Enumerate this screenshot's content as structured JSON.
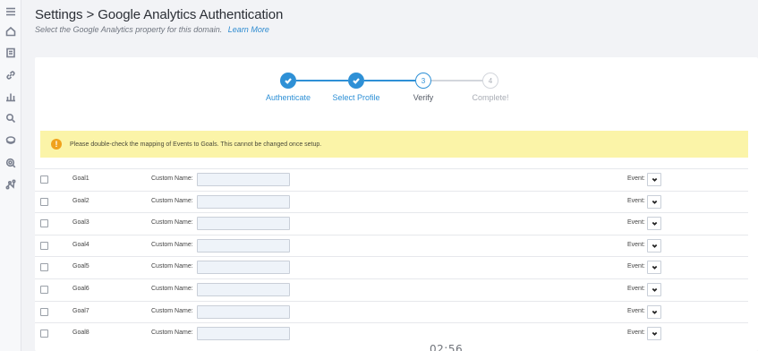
{
  "header": {
    "title": "Settings > Google Analytics Authentication",
    "subtitle": "Select the Google Analytics property for this domain.",
    "learn_more": "Learn More"
  },
  "sidebar": {
    "icons": [
      "menu-icon",
      "home-icon",
      "document-icon",
      "link-icon",
      "bar-chart-icon",
      "search-icon",
      "layers-icon",
      "zoom-icon",
      "network-icon"
    ]
  },
  "stepper": {
    "steps": [
      {
        "label": "Authenticate",
        "state": "done",
        "number": ""
      },
      {
        "label": "Select Profile",
        "state": "done",
        "number": ""
      },
      {
        "label": "Verify",
        "state": "current",
        "number": "3"
      },
      {
        "label": "Complete!",
        "state": "todo",
        "number": "4"
      }
    ]
  },
  "alert": {
    "icon": "!",
    "text": "Please double-check the mapping of Events to Goals. This cannot be changed once setup."
  },
  "goals": {
    "custom_name_label": "Custom Name:",
    "event_label": "Event:",
    "rows": [
      {
        "name": "Goal1"
      },
      {
        "name": "Goal2"
      },
      {
        "name": "Goal3"
      },
      {
        "name": "Goal4"
      },
      {
        "name": "Goal5"
      },
      {
        "name": "Goal6"
      },
      {
        "name": "Goal7"
      },
      {
        "name": "Goal8"
      }
    ]
  },
  "overlay": {
    "timer": "02:56"
  },
  "colors": {
    "accent": "#2e90d6",
    "alert_bg": "#fbf4a8",
    "alert_icon": "#f0a21c"
  }
}
